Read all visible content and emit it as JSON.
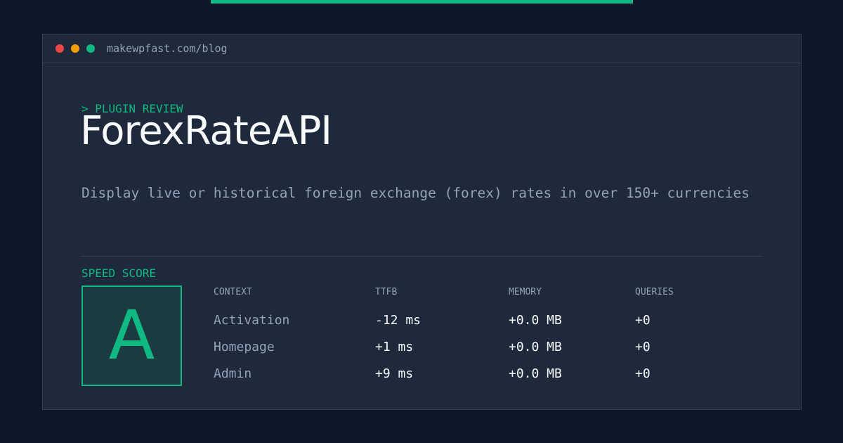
{
  "window": {
    "url": "makewpfast.com/blog"
  },
  "header": {
    "eyebrow": "> PLUGIN REVIEW",
    "title": "ForexRateAPI",
    "description": "Display live or historical foreign exchange (forex) rates in over 150+ currencies"
  },
  "score": {
    "label": "SPEED SCORE",
    "grade": "A"
  },
  "metrics": {
    "columns": [
      "CONTEXT",
      "TTFB",
      "MEMORY",
      "QUERIES"
    ],
    "rows": [
      [
        "Activation",
        "-12 ms",
        "+0.0 MB",
        "+0"
      ],
      [
        "Homepage",
        "+1 ms",
        "+0.0 MB",
        "+0"
      ],
      [
        "Admin",
        "+9 ms",
        "+0.0 MB",
        "+0"
      ]
    ]
  },
  "colors": {
    "background": "#0f172a",
    "panel": "#1e293b",
    "accent": "#10b981",
    "muted_text": "#94a3b8",
    "primary_text": "#f8fafc",
    "window_close": "#ef4444",
    "window_minimize": "#f59e0b",
    "window_maximize": "#10b981"
  }
}
